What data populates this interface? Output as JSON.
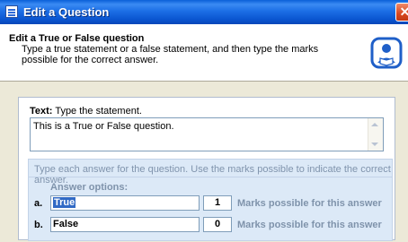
{
  "window": {
    "title": "Edit a Question",
    "close_symbol": "✕"
  },
  "header": {
    "title": "Edit a True or False question",
    "description": "Type a true statement or a false statement, and then type the marks possible for the correct answer."
  },
  "text_section": {
    "label_bold": "Text:",
    "label_rest": " Type the statement.",
    "value": "This is a True or False question."
  },
  "answers": {
    "instruction": "Type each answer for the question. Use the marks possible to indicate the correct answer.",
    "options_title": "Answer options:",
    "rows": [
      {
        "letter": "a.",
        "answer": "True",
        "marks": "1",
        "marks_label": "Marks possible for this answer"
      },
      {
        "letter": "b.",
        "answer": "False",
        "marks": "0",
        "marks_label": "Marks possible for this answer"
      }
    ]
  },
  "icons": {
    "window": "question-window-icon",
    "header": "user-book-icon"
  },
  "colors": {
    "titlebar": "#0a55d0",
    "panel_band": "#dce9f7",
    "selection": "#316ac5",
    "close": "#d8471f"
  }
}
